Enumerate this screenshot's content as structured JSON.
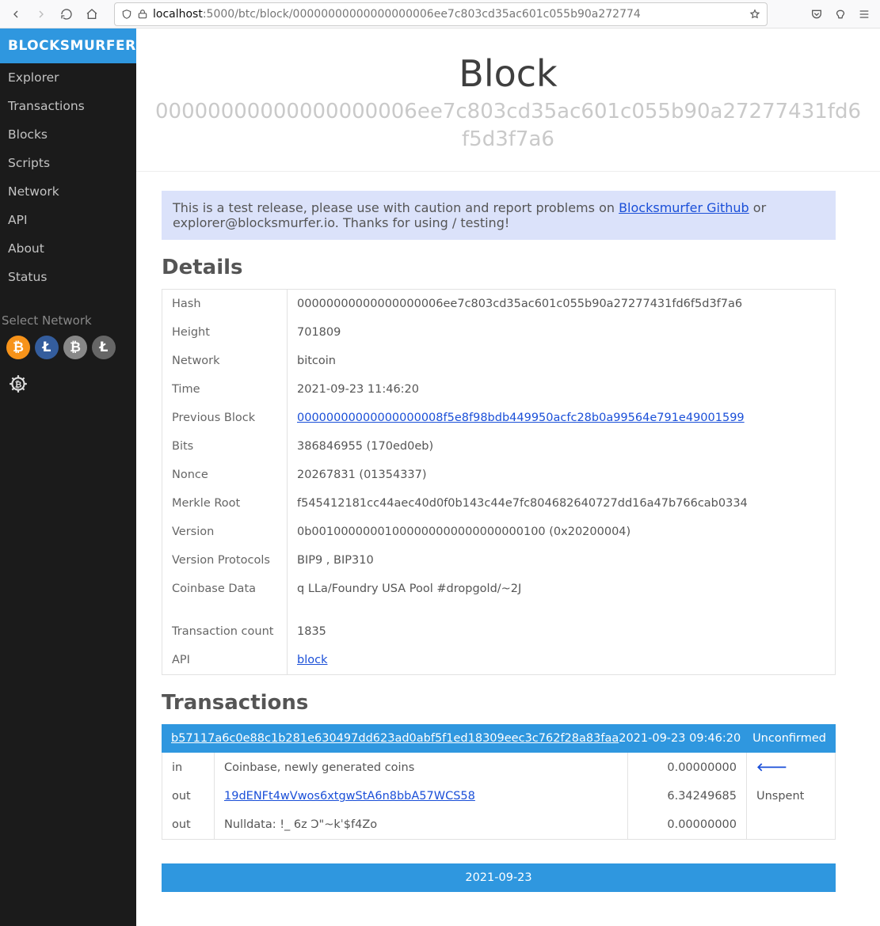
{
  "browser": {
    "url_host": "localhost",
    "url_path": ":5000/btc/block/00000000000000000006ee7c803cd35ac601c055b90a272774"
  },
  "brand": "BLOCKSMURFER",
  "nav": [
    "Explorer",
    "Transactions",
    "Blocks",
    "Scripts",
    "Network",
    "API",
    "About",
    "Status"
  ],
  "select_network_label": "Select Network",
  "coins": [
    "₿",
    "Ł",
    "₿",
    "Ł"
  ],
  "page_title": "Block",
  "page_hash": "00000000000000000006ee7c803cd35ac601c055b90a27277431fd6f5d3f7a6",
  "notice": {
    "pre": "This is a test release, please use with caution and report problems on ",
    "link": "Blocksmurfer Github",
    "post": " or explorer@blocksmurfer.io. Thanks for using / testing!"
  },
  "details_heading": "Details",
  "details": [
    {
      "k": "Hash",
      "v": "00000000000000000006ee7c803cd35ac601c055b90a27277431fd6f5d3f7a6"
    },
    {
      "k": "Height",
      "v": "701809"
    },
    {
      "k": "Network",
      "v": "bitcoin"
    },
    {
      "k": "Time",
      "v": "2021-09-23 11:46:20"
    },
    {
      "k": "Previous Block",
      "v": "00000000000000000008f5e8f98bdb449950acfc28b0a99564e791e49001599",
      "link": true
    },
    {
      "k": "Bits",
      "v": "386846955 (170ed0eb)"
    },
    {
      "k": "Nonce",
      "v": "20267831 (01354337)"
    },
    {
      "k": "Merkle Root",
      "v": "f545412181cc44aec40d0f0b143c44e7fc804682640727dd16a47b766cab0334"
    },
    {
      "k": "Version",
      "v": "0b00100000001000000000000000000100 (0x20200004)"
    },
    {
      "k": "Version Protocols",
      "v": "BIP9 , BIP310"
    },
    {
      "k": "Coinbase Data",
      "v": "q LLa/Foundry USA Pool #dropgold/~2J"
    },
    {
      "k": "Transaction count",
      "v": "1835"
    },
    {
      "k": "API",
      "v": "block",
      "link": true
    }
  ],
  "tx_heading": "Transactions",
  "tx_header": {
    "id": "b57117a6c0e88c1b281e630497dd623ad0abf5f1ed18309eec3c762f28a83faa",
    "time": "2021-09-23 09:46:20",
    "status": "Unconfirmed"
  },
  "tx_rows": [
    {
      "dir": "in",
      "desc": "Coinbase, newly generated coins",
      "amount": "0.00000000",
      "extra": "arrow"
    },
    {
      "dir": "out",
      "desc": "19dENFt4wVwos6xtgwStA6n8bbA57WCS58",
      "link": true,
      "amount": "6.34249685",
      "extra": "Unspent"
    },
    {
      "dir": "out",
      "desc": "Nulldata: !_ 6z Ɔ\"~kˈ$f4Zo",
      "amount": "0.00000000",
      "extra": ""
    }
  ],
  "next_header": "2021-09-23"
}
